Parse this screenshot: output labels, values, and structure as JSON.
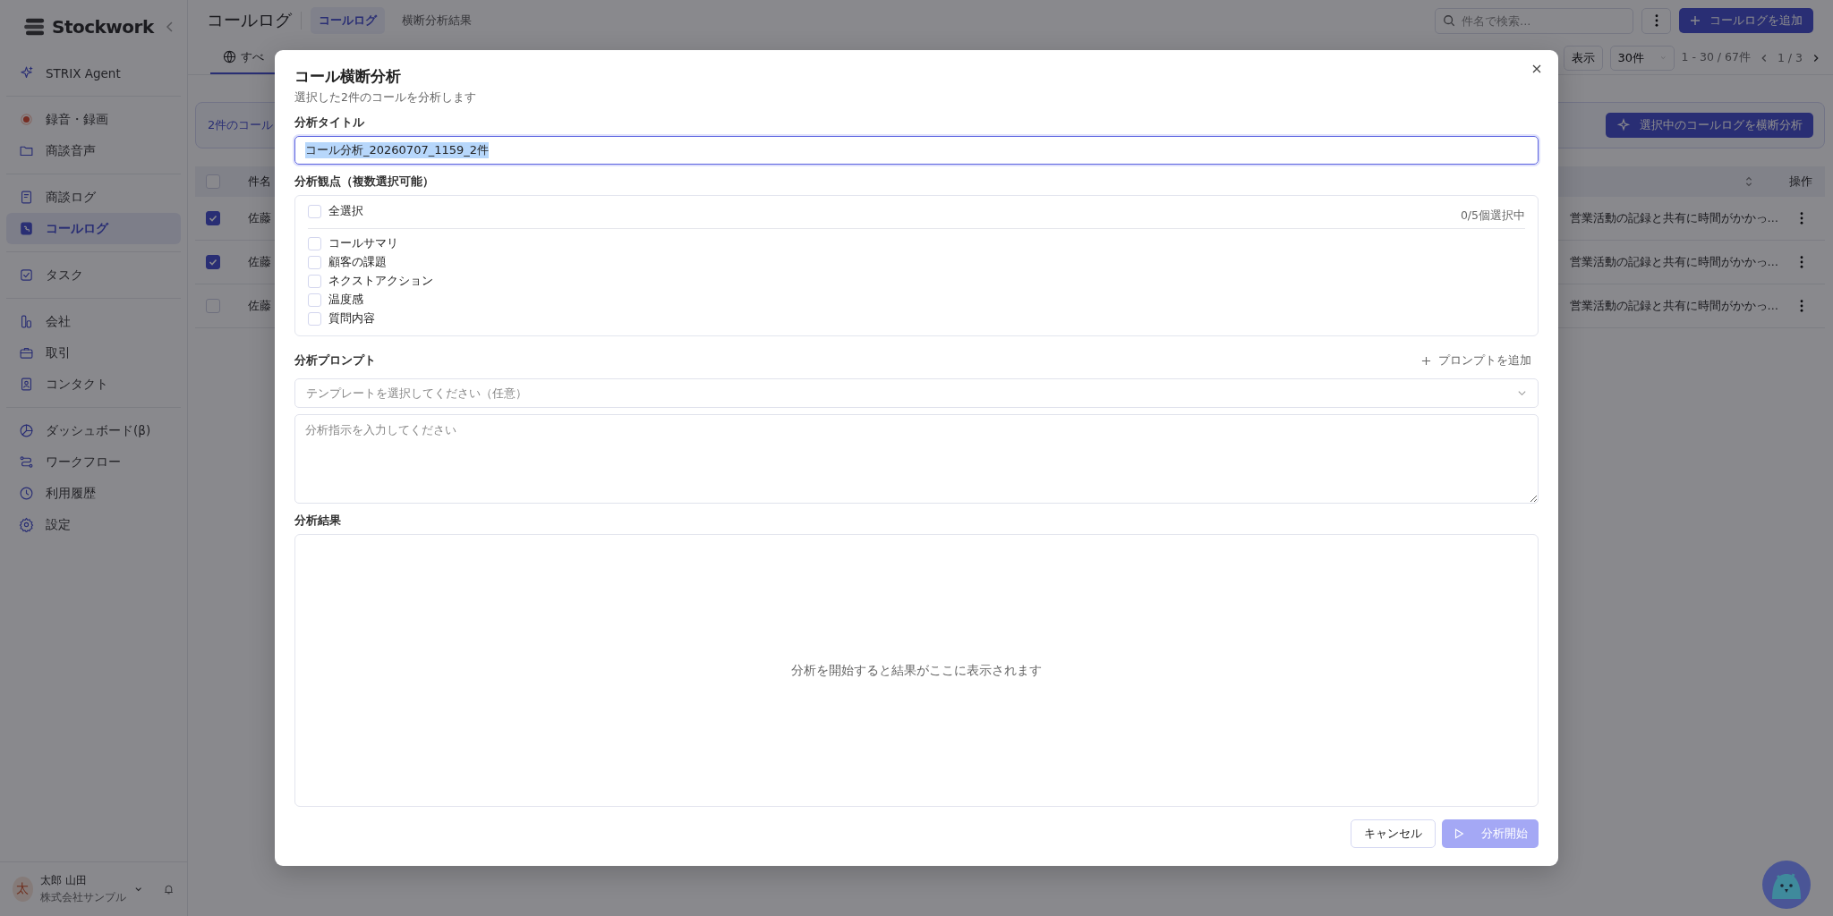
{
  "sidebar": {
    "logo": "Stockwork",
    "groups": [
      {
        "items": [
          {
            "label": "STRIX Agent",
            "selected": false
          }
        ]
      },
      {
        "items": [
          {
            "label": "録音・録画",
            "selected": false
          },
          {
            "label": "商談音声",
            "selected": false
          }
        ]
      },
      {
        "items": [
          {
            "label": "商談ログ",
            "selected": false
          },
          {
            "label": "コールログ",
            "selected": true
          }
        ]
      },
      {
        "items": [
          {
            "label": "タスク",
            "selected": false
          }
        ]
      },
      {
        "items": [
          {
            "label": "会社",
            "selected": false
          },
          {
            "label": "取引",
            "selected": false
          },
          {
            "label": "コンタクト",
            "selected": false
          }
        ]
      },
      {
        "items": [
          {
            "label": "ダッシュボード(β)",
            "selected": false
          },
          {
            "label": "ワークフロー",
            "selected": false
          },
          {
            "label": "利用履歴",
            "selected": false
          },
          {
            "label": "設定",
            "selected": false
          }
        ]
      }
    ],
    "user": {
      "avatar": "太",
      "name": "太郎 山田",
      "company": "株式会社サンプル"
    }
  },
  "header": {
    "title": "コールログ",
    "tabs": [
      {
        "label": "コールログ",
        "selected": true
      },
      {
        "label": "横断分析結果",
        "selected": false
      }
    ],
    "search": {
      "placeholder": "件名で検索..."
    },
    "add_button": "コールログを追加",
    "view_tab": "すべ",
    "display_button": "表示",
    "page_size": "30件",
    "range": "1 - 30 / 67件",
    "page": "1 / 3"
  },
  "banner": {
    "text": "2件のコール",
    "button": "選択中のコールログを横断分析"
  },
  "table": {
    "header_checked": false,
    "columns": [
      "件名",
      "操作"
    ],
    "rows": [
      {
        "checked": true,
        "title": "佐藤",
        "summary": "営業活動の記録と共有に時間がかかっ…"
      },
      {
        "checked": true,
        "title": "佐藤",
        "summary": "営業活動の記録と共有に時間がかかっ…"
      },
      {
        "checked": false,
        "title": "佐藤",
        "summary": "営業活動の記録と共有に時間がかかっ…"
      }
    ]
  },
  "modal": {
    "title": "コール横断分析",
    "subtitle": "選択した2件のコールを分析します",
    "title_field": {
      "label": "分析タイトル",
      "value": "コール分析_20260707_1159_2件",
      "selected": true
    },
    "perspectives": {
      "label": "分析観点（複数選択可能）",
      "select_all": {
        "label": "全選択",
        "checked": false
      },
      "count": "0/5個選択中",
      "items": [
        {
          "label": "コールサマリ",
          "checked": false
        },
        {
          "label": "顧客の課題",
          "checked": false
        },
        {
          "label": "ネクストアクション",
          "checked": false
        },
        {
          "label": "温度感",
          "checked": false
        },
        {
          "label": "質問内容",
          "checked": false
        }
      ]
    },
    "prompt": {
      "label": "分析プロンプト",
      "add_button": "プロンプトを追加",
      "template": {
        "placeholder": "テンプレートを選択してください（任意）"
      },
      "instruction": {
        "placeholder": "分析指示を入力してください"
      }
    },
    "result": {
      "label": "分析結果",
      "empty_text": "分析を開始すると結果がここに表示されます"
    },
    "buttons": {
      "cancel": "キャンセル",
      "start": {
        "label": "分析開始",
        "disabled": true
      }
    }
  }
}
